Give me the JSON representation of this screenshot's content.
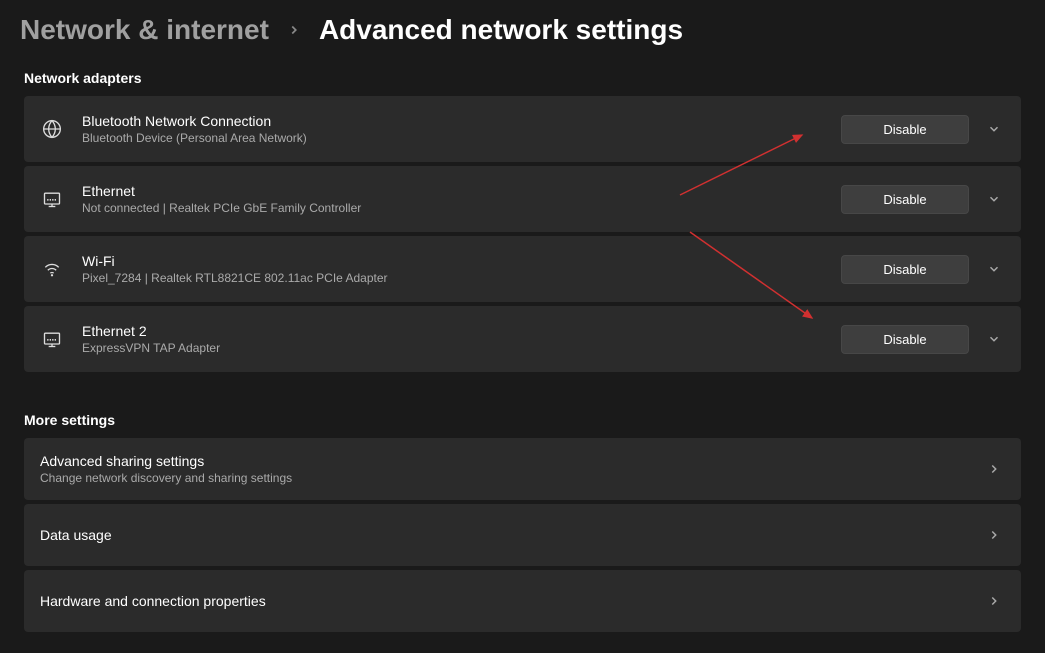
{
  "breadcrumb": {
    "parent": "Network & internet",
    "title": "Advanced network settings"
  },
  "sections": {
    "adapters_label": "Network adapters",
    "more_label": "More settings"
  },
  "adapters": [
    {
      "icon": "globe-icon",
      "title": "Bluetooth Network Connection",
      "subtitle": "Bluetooth Device (Personal Area Network)",
      "button": "Disable"
    },
    {
      "icon": "ethernet-icon",
      "title": "Ethernet",
      "subtitle": "Not connected | Realtek PCIe GbE Family Controller",
      "button": "Disable"
    },
    {
      "icon": "wifi-icon",
      "title": "Wi-Fi",
      "subtitle": "Pixel_7284 | Realtek RTL8821CE 802.11ac PCIe Adapter",
      "button": "Disable"
    },
    {
      "icon": "ethernet-icon",
      "title": "Ethernet 2",
      "subtitle": "ExpressVPN TAP Adapter",
      "button": "Disable"
    }
  ],
  "more_settings": [
    {
      "title": "Advanced sharing settings",
      "subtitle": "Change network discovery and sharing settings"
    },
    {
      "title": "Data usage",
      "subtitle": ""
    },
    {
      "title": "Hardware and connection properties",
      "subtitle": ""
    }
  ]
}
